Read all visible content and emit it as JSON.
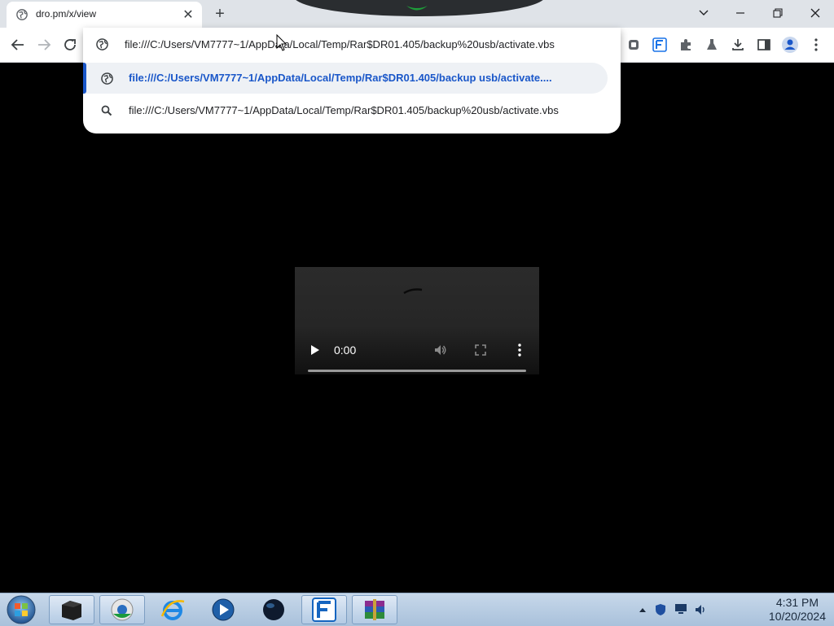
{
  "browser": {
    "tab": {
      "title": "dro.pm/x/view"
    },
    "omnibox": {
      "input_text": "file:///C:/Users/VM7777~1/AppData/Local/Temp/Rar$DR01.405/backup%20usb/activate.vbs",
      "suggestions": [
        {
          "text": "file:///C:/Users/VM7777~1/AppData/Local/Temp/Rar$DR01.405/backup usb/activate....",
          "icon": "globe-icon",
          "selected": true
        },
        {
          "text": "file:///C:/Users/VM7777~1/AppData/Local/Temp/Rar$DR01.405/backup%20usb/activate.vbs",
          "icon": "search-icon",
          "selected": false
        }
      ]
    },
    "accent_color": "#1a57c9"
  },
  "video_player": {
    "current_time": "0:00"
  },
  "taskbar": {
    "clock_time": "4:31 PM",
    "clock_date": "10/20/2024"
  }
}
